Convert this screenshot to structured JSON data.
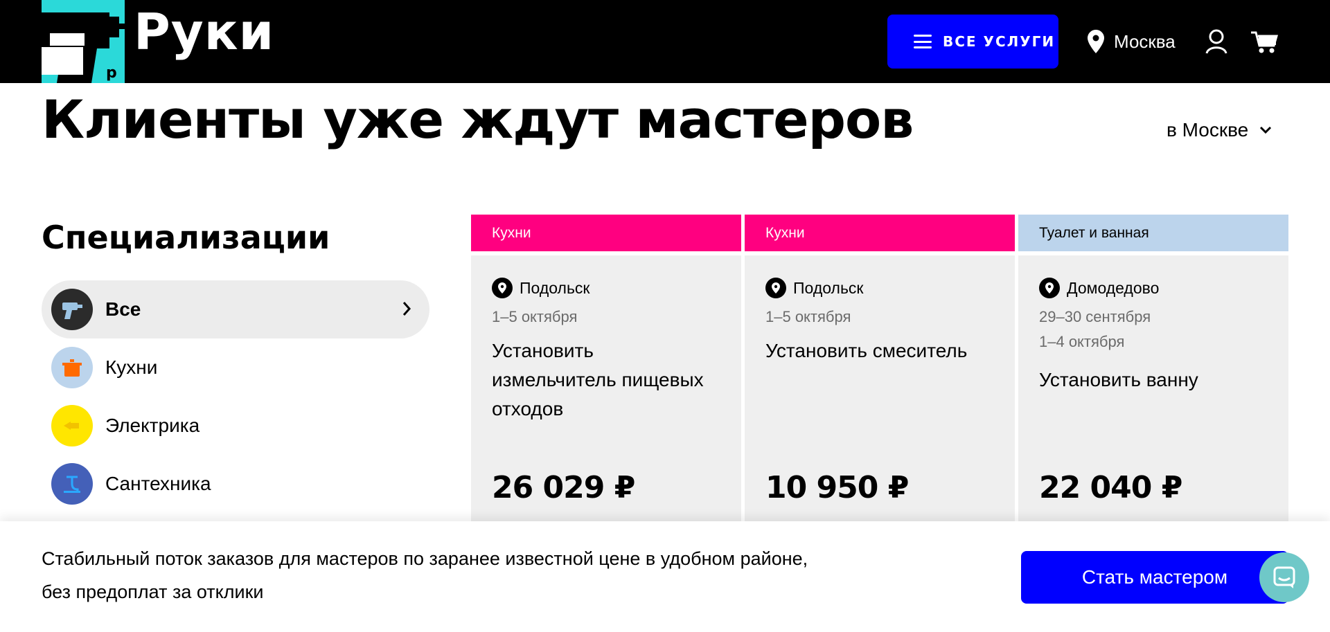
{
  "header": {
    "logo_text": "Руки",
    "menu_label": "ВСЕ УСЛУГИ",
    "city": "Москва"
  },
  "main": {
    "title": "Клиенты уже ждут мастеров",
    "city_select": "в Москве"
  },
  "sidebar": {
    "title": "Специализации",
    "items": [
      {
        "label": "Все",
        "icon": "drill-icon",
        "color": "#2b2b2b",
        "active": true
      },
      {
        "label": "Кухни",
        "icon": "pot-icon",
        "color": "#bcd4ec"
      },
      {
        "label": "Электрика",
        "icon": "plug-icon",
        "color": "#ffe600"
      },
      {
        "label": "Сантехника",
        "icon": "faucet-icon",
        "color": "#4460b8"
      }
    ]
  },
  "cards": [
    {
      "category": "Кухни",
      "category_color": "#ff0080",
      "category_text_color": "#ffffff",
      "location": "Подольск",
      "dates": [
        "1–5 октября"
      ],
      "task": "Установить измельчитель пищевых отходов",
      "price": "26 029 ₽"
    },
    {
      "category": "Кухни",
      "category_color": "#ff0080",
      "category_text_color": "#ffffff",
      "location": "Подольск",
      "dates": [
        "1–5 октября"
      ],
      "task": "Установить смеситель",
      "price": "10 950 ₽"
    },
    {
      "category": "Туалет и ванная",
      "category_color": "#bcd4ec",
      "category_text_color": "#000000",
      "location": "Домодедово",
      "dates": [
        "29–30 сентября",
        "1–4 октября"
      ],
      "task": "Установить ванну",
      "price": "22 040 ₽"
    }
  ],
  "bottom": {
    "text_line1": "Стабильный поток заказов для мастеров по заранее известной цене в удобном районе,",
    "text_line2": "без предоплат за отклики",
    "cta_label": "Стать мастером"
  },
  "colors": {
    "accent": "#0000ff",
    "logo_bg": "#2bd9d9",
    "chat_bg": "#6fc8c8"
  }
}
